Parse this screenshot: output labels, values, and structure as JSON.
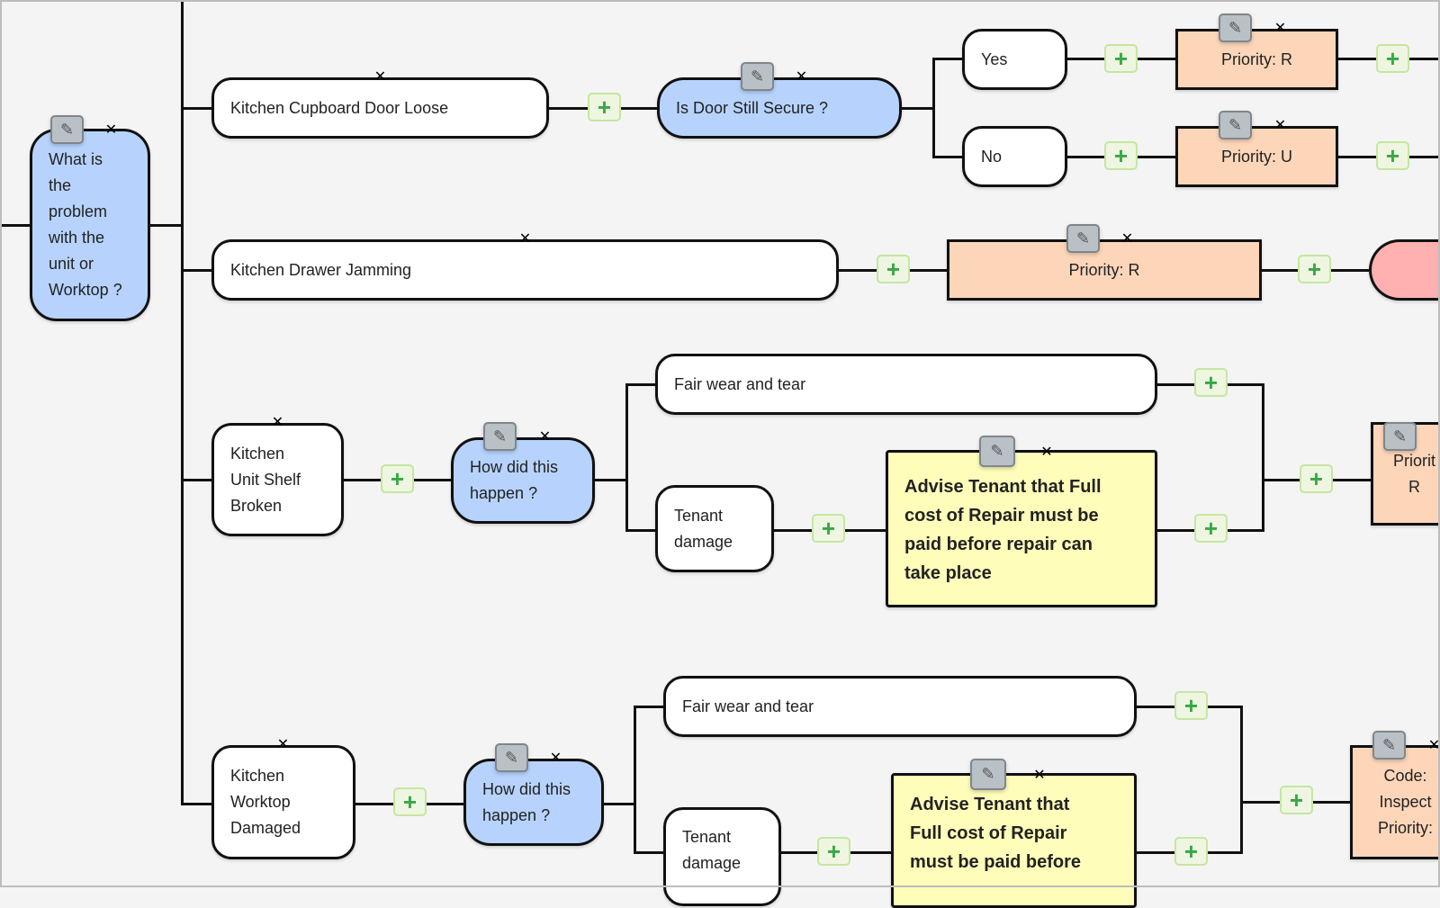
{
  "icons": {
    "edit": "pencil-icon",
    "delete": "close-icon",
    "add": "plus-icon"
  },
  "glyphs": {
    "edit": "✎",
    "delete": "✕",
    "add": "+"
  },
  "colors": {
    "question": "#b7d3fd",
    "answer": "#ffffff",
    "priority": "#fdd6ba",
    "advice": "#fffdb9",
    "end": "#ffb0b0",
    "delete": "#e0195a",
    "add": "#36a845"
  },
  "root": {
    "text": "What is\nthe\nproblem\nwith the\nunit or\nWorktop ?"
  },
  "branches": [
    {
      "answer": "Kitchen Cupboard Door Loose",
      "question": "Is Door Still Secure ?",
      "options": [
        {
          "answer": "Yes",
          "outcome": "Priority: R"
        },
        {
          "answer": "No",
          "outcome": "Priority: U"
        }
      ]
    },
    {
      "answer": "Kitchen Drawer Jamming",
      "outcome": "Priority: R"
    },
    {
      "answer": "Kitchen\nUnit Shelf\nBroken",
      "question": "How did this\nhappen ?",
      "options": [
        {
          "answer": "Fair wear and tear"
        },
        {
          "answer": "Tenant\ndamage",
          "advice": "Advise Tenant that Full\ncost of Repair must be\npaid before repair can\ntake place"
        }
      ],
      "outcome": "Priorit\nR"
    },
    {
      "answer": "Kitchen\nWorktop\nDamaged",
      "question": "How did this\nhappen ?",
      "options": [
        {
          "answer": "Fair wear and tear"
        },
        {
          "answer": "Tenant\ndamage",
          "advice": "Advise Tenant that\nFull cost of Repair\nmust be paid before"
        }
      ],
      "outcome": "Code:\nInspect\nPriority:"
    }
  ]
}
